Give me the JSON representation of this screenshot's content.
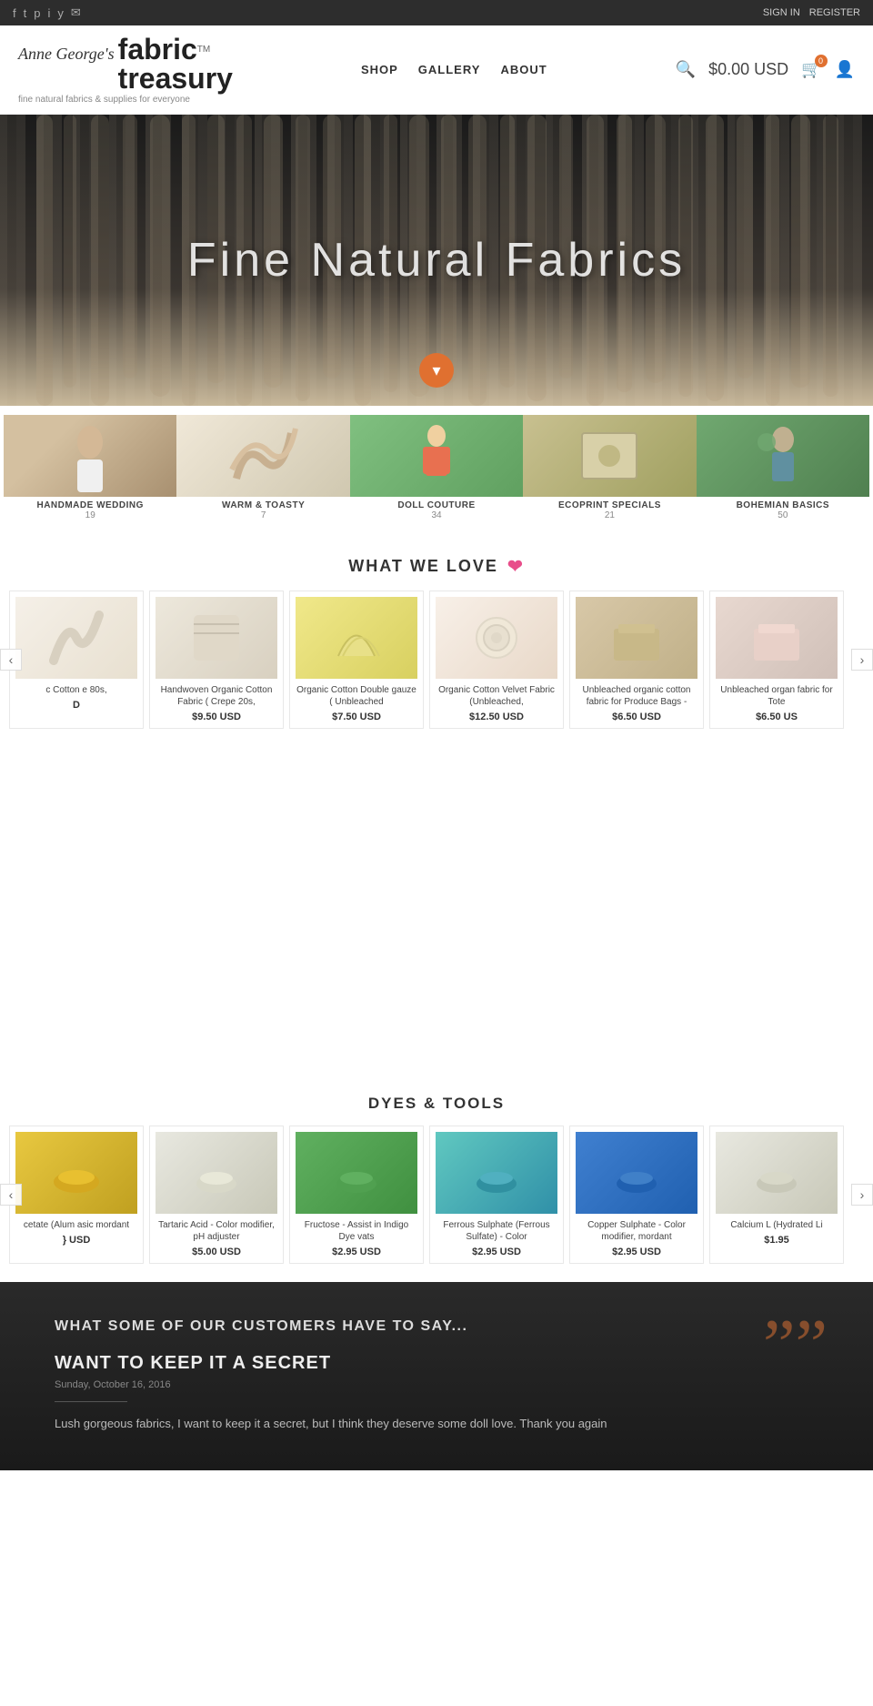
{
  "topbar": {
    "social": [
      "facebook",
      "twitter",
      "pinterest",
      "instagram",
      "youtube",
      "email"
    ],
    "auth": [
      "SIGN IN",
      "REGISTER"
    ]
  },
  "header": {
    "logo_script": "Anne George's",
    "logo_line1": "fabric",
    "logo_line2": "treasury",
    "logo_tm": "TM",
    "logo_sub": "fine natural fabrics & supplies for everyone",
    "nav": [
      "SHOP",
      "GALLERY",
      "ABOUT"
    ],
    "cart_price": "$0.00 USD",
    "cart_count": "0"
  },
  "hero": {
    "text": "Fine Natural Fabrics",
    "scroll_icon": "▾"
  },
  "categories": [
    {
      "name": "HANDMADE WEDDING",
      "count": "19",
      "img_class": "cat-woman"
    },
    {
      "name": "WARM & TOASTY",
      "count": "7",
      "img_class": "cat-fabric"
    },
    {
      "name": "DOLL COUTURE",
      "count": "34",
      "img_class": "cat-doll"
    },
    {
      "name": "ECOPRINT SPECIALS",
      "count": "21",
      "img_class": "cat-eco"
    },
    {
      "name": "BOHEMIAN BASICS",
      "count": "50",
      "img_class": "cat-outdoor"
    }
  ],
  "what_we_love": {
    "title": "WHAT WE LOVE",
    "arrow_left": "‹",
    "arrow_right": "›",
    "products": [
      {
        "name": "c Cotton e 80s,",
        "price": "D",
        "img_class": "pi-cream"
      },
      {
        "name": "Handwoven Organic Cotton Fabric ( Crepe 20s,",
        "price": "$9.50 USD",
        "img_class": "pi-cream2"
      },
      {
        "name": "Organic Cotton Double gauze ( Unbleached",
        "price": "$7.50 USD",
        "img_class": "pi-yellow"
      },
      {
        "name": "Organic Cotton Velvet Fabric (Unbleached,",
        "price": "$12.50 USD",
        "img_class": "pi-pale"
      },
      {
        "name": "Unbleached organic cotton fabric for Produce Bags -",
        "price": "$6.50 USD",
        "img_class": "pi-tan"
      },
      {
        "name": "Unbleached organ fabric for Tote",
        "price": "$6.50 US",
        "img_class": "pi-powder"
      }
    ]
  },
  "dyes_tools": {
    "title": "DYES & TOOLS",
    "arrow_left": "‹",
    "arrow_right": "›",
    "products": [
      {
        "name": "cetate (Alum asic mordant",
        "price": "} USD",
        "img_class": "pi-gold"
      },
      {
        "name": "Tartaric Acid - Color modifier, pH adjuster",
        "price": "$5.00 USD",
        "img_class": "pi-salt"
      },
      {
        "name": "Fructose - Assist in Indigo Dye vats",
        "price": "$2.95 USD",
        "img_class": "pi-green"
      },
      {
        "name": "Ferrous Sulphate (Ferrous Sulfate) - Color",
        "price": "$2.95 USD",
        "img_class": "pi-teal"
      },
      {
        "name": "Copper Sulphate - Color modifier, mordant",
        "price": "$2.95 USD",
        "img_class": "pi-blue"
      },
      {
        "name": "Calcium L (Hydrated Li",
        "price": "$1.95",
        "img_class": "pi-salt"
      }
    ]
  },
  "testimonials": {
    "section_title": "WHAT SOME OF OUR CUSTOMERS HAVE TO SAY...",
    "review_title": "WANT TO KEEP IT A SECRET",
    "review_date": "Sunday, October 16, 2016",
    "review_text": "Lush gorgeous fabrics, I want to keep it a secret, but I think they deserve some doll love. Thank you again",
    "quote_mark": "””"
  }
}
